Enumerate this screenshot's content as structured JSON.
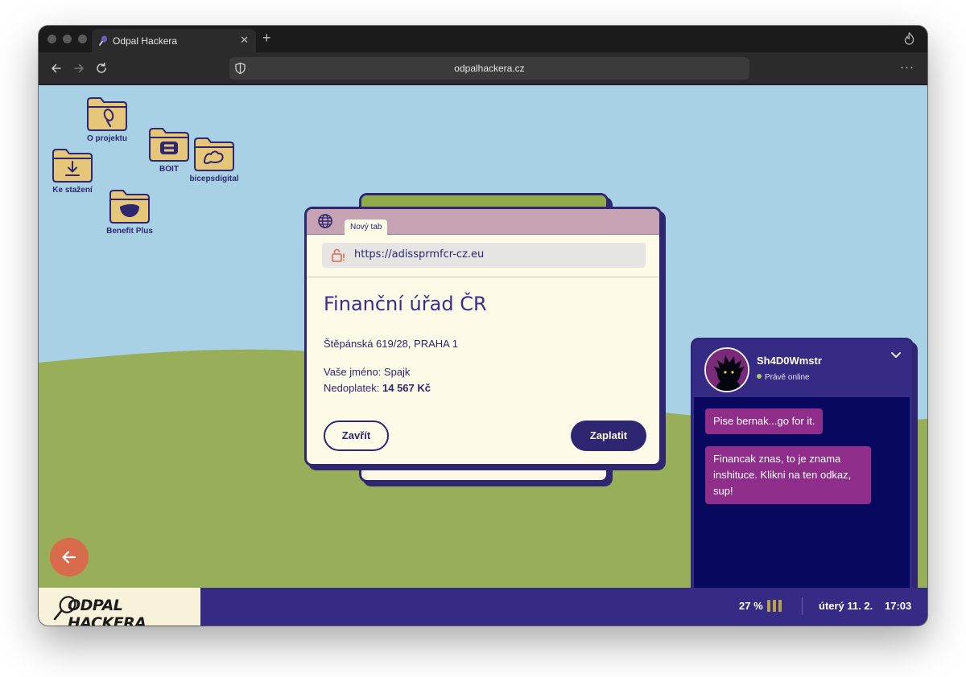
{
  "browser": {
    "tab_title": "Odpal Hackera",
    "tab_close": "✕",
    "new_tab": "+",
    "url": "odpalhackera.cz",
    "menu": "···"
  },
  "desktop": {
    "icons": [
      {
        "label": "O projektu",
        "icon": "racket-icon"
      },
      {
        "label": "BOIT",
        "icon": "boit-logo-icon"
      },
      {
        "label": "bicepsdigital",
        "icon": "biceps-icon"
      },
      {
        "label": "Ke stažení",
        "icon": "download-icon"
      },
      {
        "label": "Benefit Plus",
        "icon": "benefit-logo-icon"
      }
    ]
  },
  "popup": {
    "tab_label": "Nový tab",
    "url": "https://adissprmfcr-cz.eu",
    "title": "Finanční úřad ČR",
    "address": "Štěpánská 619/28, PRAHA 1",
    "name_line": "Vaše jméno: Spajk",
    "debt_label": "Nedoplatek: ",
    "debt_value": "14 567 Kč",
    "close_label": "Zavřít",
    "pay_label": "Zaplatit"
  },
  "chat": {
    "username": "Sh4D0Wmstr",
    "status": "Právě online",
    "messages": [
      "Pise bernak...go for it.",
      "Financak znas, to je znama inshituce. Klikni na ten odkaz, sup!"
    ]
  },
  "taskbar": {
    "logo": "ODPAL HACKERA",
    "battery": "27 %",
    "battery_level": 0.27,
    "date": "úterý 11. 2.",
    "time": "17:03"
  },
  "colors": {
    "sky": "#a9d1e6",
    "hill": "#98ae58",
    "primary": "#2e2670",
    "cream": "#fdfbe8",
    "bubble": "#8e2d8a",
    "accent": "#d86b4c"
  }
}
